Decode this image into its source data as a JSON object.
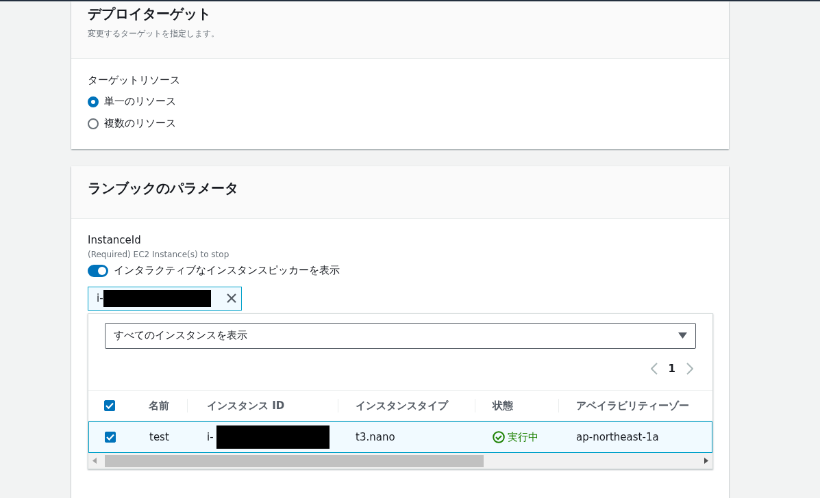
{
  "deploy_target": {
    "title": "デプロイターゲット",
    "description": "変更するターゲットを指定します。",
    "field_label": "ターゲットリソース",
    "options": [
      {
        "label": "単一のリソース",
        "selected": true
      },
      {
        "label": "複数のリソース",
        "selected": false
      }
    ]
  },
  "runbook_parameters": {
    "title": "ランブックのパラメータ",
    "param_label": "InstanceId",
    "param_description": "(Required) EC2 Instance(s) to stop",
    "toggle": {
      "label": "インタラクティブなインスタンスピッカーを表示",
      "on": true
    },
    "selected_token": {
      "value": "i-"
    },
    "filter": {
      "value": "すべてのインスタンスを表示"
    },
    "pagination": {
      "page": "1"
    },
    "table": {
      "select_all": true,
      "columns": [
        "名前",
        "インスタンス ID",
        "インスタンスタイプ",
        "状態",
        "アベイラビリティーゾー"
      ],
      "rows": [
        {
          "selected": true,
          "name": "test",
          "instance_id": "i-",
          "type": "t3.nano",
          "state": "実行中",
          "zone": "ap-northeast-1a"
        }
      ]
    }
  }
}
